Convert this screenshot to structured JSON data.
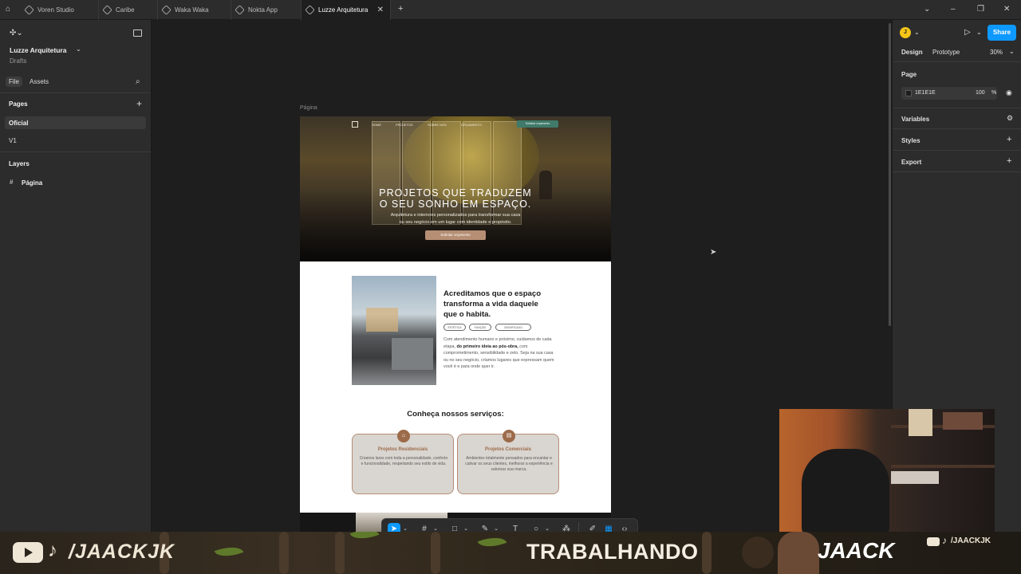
{
  "tabs": [
    {
      "label": "Voren Studio"
    },
    {
      "label": "Caribe"
    },
    {
      "label": "Waka Waka"
    },
    {
      "label": "Nokta App"
    },
    {
      "label": "Luzze Arquitetura",
      "active": true
    }
  ],
  "left": {
    "project_name": "Luzze Arquitetura",
    "project_location": "Drafts",
    "tab_file": "File",
    "tab_assets": "Assets",
    "pages_title": "Pages",
    "pages": [
      "Oficial",
      "V1"
    ],
    "layers_title": "Layers",
    "layers": [
      "Página"
    ]
  },
  "right": {
    "avatar_initial": "J",
    "share_label": "Share",
    "tab_design": "Design",
    "tab_prototype": "Prototype",
    "zoom": "30%",
    "page_section": "Page",
    "page_color": "1E1E1E",
    "page_opacity": "100",
    "opacity_unit": "%",
    "variables": "Variables",
    "styles": "Styles",
    "export": "Export"
  },
  "canvas": {
    "frame_label": "Página",
    "nav": [
      "HOME",
      "PROJETOS",
      "SOBRE NÓS",
      "ORÇAMENTO"
    ],
    "nav_cta": "Solicitar orçamento",
    "hero_title_1": "PROJETOS QUE TRADUZEM",
    "hero_title_2": "O SEU SONHO EM ESPAÇO.",
    "hero_sub_1": "Arquitetura e interiores personalizados para transformar sua casa",
    "hero_sub_2": "ou seu negócio em um lugar com identidade e propósito.",
    "hero_cta": "Solicitar orçamento",
    "about_title_1": "Acreditamos que o espaço",
    "about_title_2": "transforma a vida daquele",
    "about_title_3": "que o habita.",
    "pills": [
      "ESTÉTICA",
      "FUNÇÃO",
      "SIGNIFICADO"
    ],
    "about_text_a": "Com atendimento humano e próximo, cuidamos de cada etapa, ",
    "about_text_bold": "do primeiro ideia ao pós-obra,",
    "about_text_b": " com comprometimento, sensibilidade e zelo. Seja na sua casa ou no seu negócio, criamos lugares que expressam quem você é e para onde quer ir.",
    "services_title": "Conheça nossos serviços:",
    "services": [
      {
        "title": "Projetos Residenciais",
        "text": "Criamos lares com toda a personalidade, conforto e funcionalidade, respeitando seu estilo de vida."
      },
      {
        "title": "Projetos Comerciais",
        "text": "Ambientes totalmente pensados para encantar e cativar os seus clientes, melhorar a experiência e valorizar sua marca."
      }
    ]
  },
  "overlay": {
    "handle": "/JAACKJK",
    "status": "TRABALHANDO",
    "brand": "JAACK",
    "handle_small": "/JAACKJK"
  },
  "colors": {
    "accent_blue": "#0d99ff",
    "brand_brown": "#9c6b4a",
    "hero_cta": "#b58e74",
    "nav_cta": "#3f7a6a"
  }
}
